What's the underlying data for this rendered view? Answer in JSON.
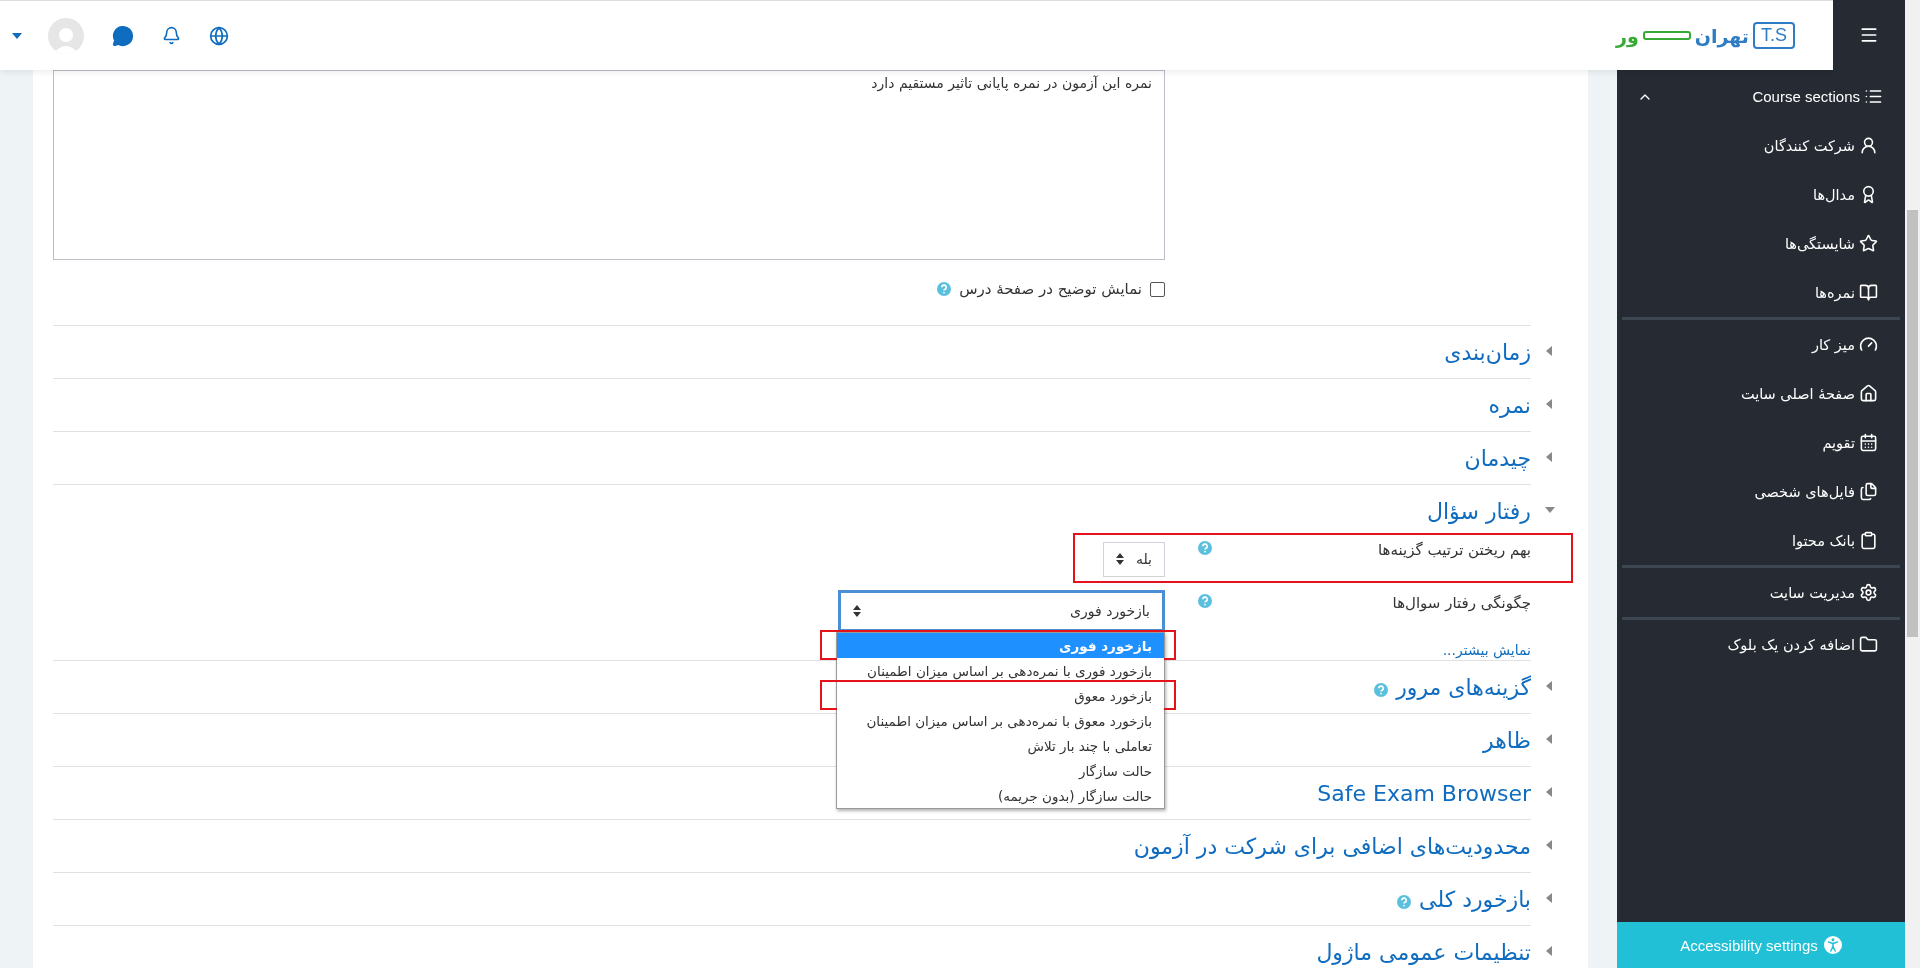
{
  "header": {
    "logo": {
      "mark": "T.S",
      "name_main": "تهران",
      "name_tail": "ور"
    }
  },
  "sidebar": {
    "course_sections": {
      "label": "Course sections",
      "expanded": true
    },
    "groups": [
      [
        {
          "label": "شرکت کنندگان"
        },
        {
          "label": "مدال‌ها"
        },
        {
          "label": "شایستگی‌ها"
        },
        {
          "label": "نمره‌ها"
        }
      ],
      [
        {
          "label": "میز کار"
        },
        {
          "label": "صفحهٔ اصلی سایت"
        },
        {
          "label": "تقویم"
        },
        {
          "label": "فایل‌های شخصی"
        },
        {
          "label": "بانک محتوا"
        }
      ],
      [
        {
          "label": "مدیریت سایت"
        }
      ],
      [
        {
          "label": "اضافه کردن یک بلوک"
        }
      ]
    ],
    "accessibility_button": "Accessibility settings"
  },
  "form": {
    "description": "نمره این آزمون در نمره پایانی تاثیر مستقیم دارد",
    "show_description": {
      "label": "نمایش توضیح در صفحهٔ درس",
      "checked": false
    },
    "sections": [
      {
        "title": "زمان‌بندی",
        "expanded": false,
        "help": false
      },
      {
        "title": "نمره",
        "expanded": false,
        "help": false
      },
      {
        "title": "چیدمان",
        "expanded": false,
        "help": false
      },
      {
        "title": "رفتار سؤال",
        "expanded": true,
        "help": false,
        "fields": [
          {
            "label": "بهم ریختن ترتیب گزینه‌ها",
            "value": "بله",
            "kind": "short",
            "focused": false,
            "highlighted": true
          },
          {
            "label": "چگونگی رفتار سوال‌ها",
            "value": "بازخورد فوری",
            "kind": "wide",
            "focused": true,
            "highlighted": false,
            "options": [
              {
                "label": "بازخورد فوری",
                "selected": true,
                "highlighted": true
              },
              {
                "label": "بازخورد فوری با نمره‌دهی بر اساس میزان اطمینان",
                "selected": false,
                "highlighted": false
              },
              {
                "label": "بازخورد معوق",
                "selected": false,
                "highlighted": true
              },
              {
                "label": "بازخورد معوق با نمره‌دهی بر اساس میزان اطمینان",
                "selected": false,
                "highlighted": false
              },
              {
                "label": "تعاملی با چند بار تلاش",
                "selected": false,
                "highlighted": false
              },
              {
                "label": "حالت سازگار",
                "selected": false,
                "highlighted": false
              },
              {
                "label": "حالت سازگار (بدون جریمه)",
                "selected": false,
                "highlighted": false
              }
            ]
          }
        ],
        "more_link": "نمایش بیشتر..."
      },
      {
        "title": "گزینه‌های مرور",
        "expanded": false,
        "help": true
      },
      {
        "title": "ظاهر",
        "expanded": false,
        "help": false
      },
      {
        "title": "Safe Exam Browser",
        "expanded": false,
        "help": false
      },
      {
        "title": "محدودیت‌های اضافی برای شرکت در آزمون",
        "expanded": false,
        "help": false
      },
      {
        "title": "بازخورد کلی",
        "expanded": false,
        "help": true
      },
      {
        "title": "تنظیمات عمومی ماژول",
        "expanded": false,
        "help": false
      }
    ]
  }
}
